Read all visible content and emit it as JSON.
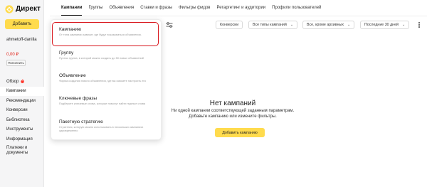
{
  "app": {
    "logo_text": "Директ",
    "brand_color": "#ffdb4d",
    "alert_color": "#d8141a"
  },
  "sidebar": {
    "add_button": "Добавить",
    "login": "ahmetoff-daniila",
    "balance": "0,00 ₽",
    "topup_button": "Пополнить",
    "items": [
      {
        "label": "Обзор",
        "icon": "fire-icon"
      },
      {
        "label": "Кампании"
      },
      {
        "label": "Рекомендации"
      },
      {
        "label": "Конверсии"
      },
      {
        "label": "Библиотека"
      },
      {
        "label": "Инструменты"
      },
      {
        "label": "Информация"
      },
      {
        "label": "Платежи и документы"
      }
    ],
    "active_index": 1
  },
  "tabs": [
    {
      "label": "Кампании",
      "active": true
    },
    {
      "label": "Группы"
    },
    {
      "label": "Объявления"
    },
    {
      "label": "Ставки и фразы"
    },
    {
      "label": "Фильтры фидов"
    },
    {
      "label": "Ретаргетинг и аудитории"
    },
    {
      "label": "Профили пользователей"
    }
  ],
  "toolbar": {
    "filters": [
      {
        "label": "Конверсии"
      },
      {
        "label": "Все типы кампаний"
      },
      {
        "label": "Все, кроме архивных"
      },
      {
        "label": "Последние 30 дней"
      }
    ]
  },
  "dropdown": {
    "items": [
      {
        "title": "Кампанию",
        "desc": "От типа кампании зависит, где будут показываться объявления."
      },
      {
        "title": "Группу",
        "desc": "Пустая группа, в которой можно создать до 50 новых объявлений"
      },
      {
        "title": "Объявление",
        "desc": "Форма создания нового объявления, где вы сможете настроить его"
      },
      {
        "title": "Ключевые фразы",
        "desc": "Подберите ключевые слова, которые помогут найти нужные слова"
      },
      {
        "title": "Пакетную стратегию",
        "desc": "Стратегия, которую можно использовать в нескольких кампаниях одновременно"
      }
    ]
  },
  "empty_state": {
    "title": "Нет кампаний",
    "line1": "Ни одной кампании соответствующей заданным параметрам.",
    "line2": "Добавьте кампанию или измените фильтры.",
    "button": "Добавить кампанию"
  }
}
